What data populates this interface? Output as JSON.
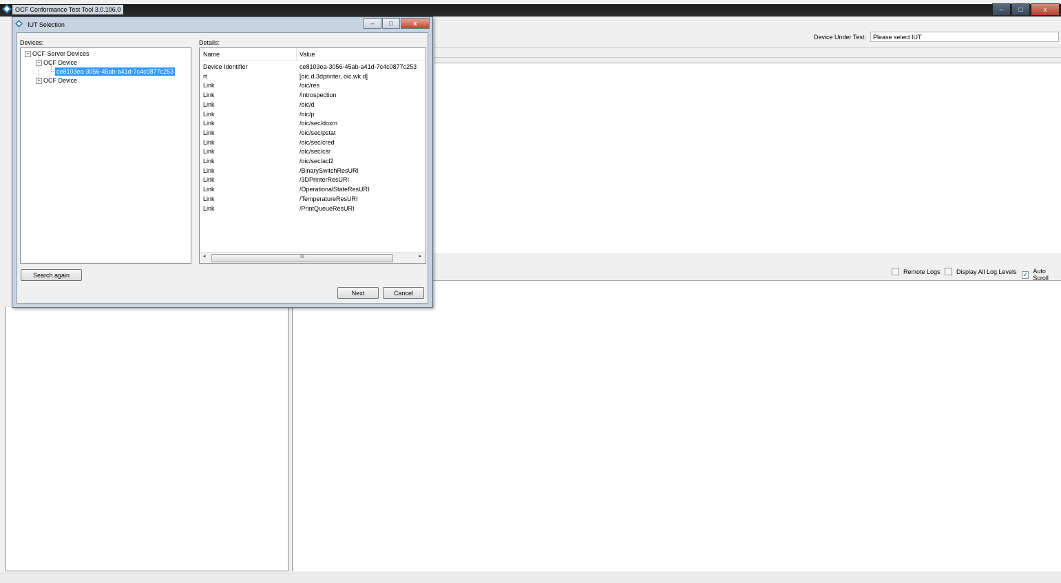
{
  "main_window": {
    "title": "OCF Conformance Test Tool 3.0.106.0",
    "controls": {
      "minimize": "–",
      "maximize": "□",
      "close": "x"
    }
  },
  "toolbar": {
    "dut_label": "Device Under Test:",
    "dut_value": "Please select IUT"
  },
  "log_options": {
    "remote_logs": {
      "label": "Remote Logs",
      "checked": false
    },
    "display_all": {
      "label": "Display All Log Levels",
      "checked": false
    },
    "auto_scroll": {
      "label": "Auto Scroll",
      "checked": true,
      "mark": "✓"
    }
  },
  "dialog": {
    "title": "IUT Selection",
    "controls": {
      "minimize": "–",
      "maximize": "□",
      "close": "x"
    },
    "devices_label": "Devices:",
    "details_label": "Details:",
    "tree": {
      "root": "OCF Server Devices",
      "root_expander": "−",
      "device1": "OCF Device",
      "device1_expander": "−",
      "device1_child": "ce8103ea-3056-45ab-a41d-7c4c0877c253",
      "device2": "OCF Device",
      "device2_expander": "+"
    },
    "details": {
      "columns": {
        "name": "Name",
        "value": "Value"
      },
      "rows": [
        {
          "name": "Device Identifier",
          "value": "ce8103ea-3056-45ab-a41d-7c4c0877c253"
        },
        {
          "name": "rt",
          "value": "[oic.d.3dprinter, oic.wk.d]"
        },
        {
          "name": "Link",
          "value": "/oic/res"
        },
        {
          "name": "Link",
          "value": "/introspection"
        },
        {
          "name": "Link",
          "value": "/oic/d"
        },
        {
          "name": "Link",
          "value": "/oic/p"
        },
        {
          "name": "Link",
          "value": "/oic/sec/doxm"
        },
        {
          "name": "Link",
          "value": "/oic/sec/pstat"
        },
        {
          "name": "Link",
          "value": "/oic/sec/cred"
        },
        {
          "name": "Link",
          "value": "/oic/sec/csr"
        },
        {
          "name": "Link",
          "value": "/oic/sec/acl2"
        },
        {
          "name": "Link",
          "value": "/BinarySwitchResURI"
        },
        {
          "name": "Link",
          "value": "/3DPrinterResURI"
        },
        {
          "name": "Link",
          "value": "/OperationalStateResURI"
        },
        {
          "name": "Link",
          "value": "/TemperatureResURI"
        },
        {
          "name": "Link",
          "value": "/PrintQueueResURI"
        }
      ],
      "scroll": {
        "left": "◂",
        "thumb": "III",
        "right": "▸"
      }
    },
    "search_again": "Search again",
    "next": "Next",
    "cancel": "Cancel"
  }
}
